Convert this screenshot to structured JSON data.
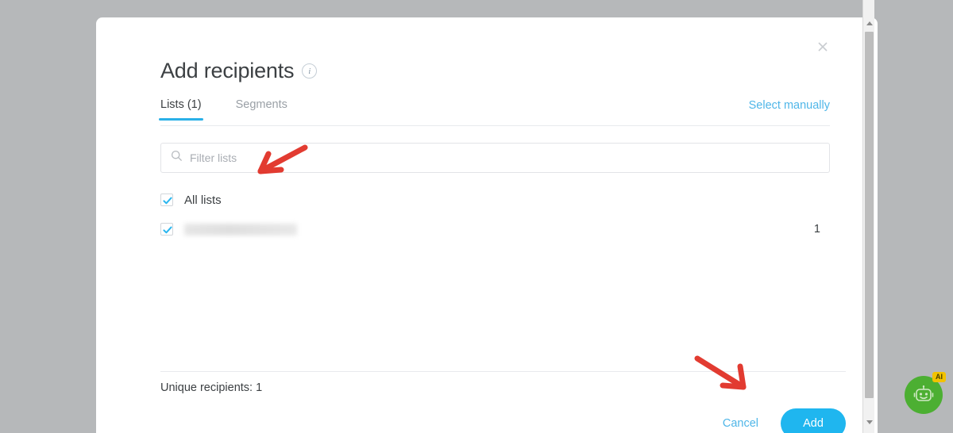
{
  "modal": {
    "title": "Add recipients",
    "info_icon": "info-icon",
    "close_icon": "close-icon",
    "tabs": [
      {
        "label": "Lists (1)",
        "active": true
      },
      {
        "label": "Segments",
        "active": false
      }
    ],
    "select_manually_label": "Select manually",
    "search": {
      "placeholder": "Filter lists",
      "value": "",
      "icon": "search-icon"
    },
    "lists": [
      {
        "label": "All lists",
        "checked": true,
        "count": "",
        "redacted": false
      },
      {
        "label": "",
        "checked": true,
        "count": "1",
        "redacted": true
      }
    ],
    "footer": {
      "unique_recipients_label": "Unique recipients: 1",
      "cancel_label": "Cancel",
      "add_label": "Add"
    }
  },
  "scrollbar": {
    "up_icon": "chevron-up-icon",
    "down_icon": "chevron-down-icon"
  },
  "ai_widget": {
    "badge": "AI",
    "icon": "robot-icon"
  },
  "annotations": [
    {
      "name": "arrow-to-all-lists-checkbox",
      "direction": "down-left"
    },
    {
      "name": "arrow-to-add-button",
      "direction": "down-right"
    }
  ],
  "colors": {
    "accent_blue": "#1fb6ef",
    "link_blue": "#4fb6e8",
    "tab_underline": "#2ab0e8",
    "text": "#3c4043",
    "muted": "#9aa0a6",
    "backdrop": "#b6b8ba",
    "annotation_red": "#e02b20",
    "ai_green": "#4caf32",
    "ai_badge_yellow": "#f2c200"
  }
}
